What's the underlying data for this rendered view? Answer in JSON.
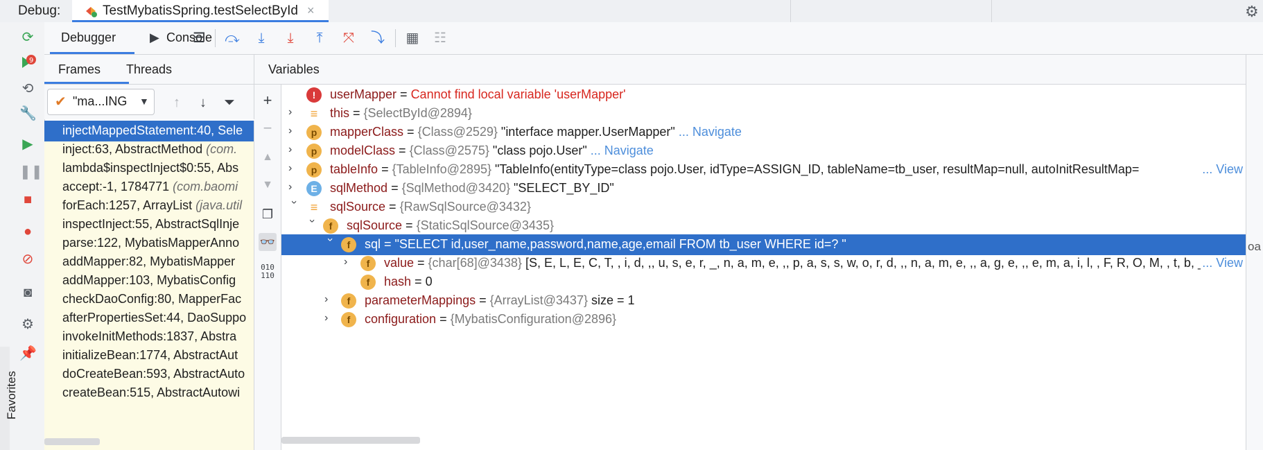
{
  "topbar": {
    "debug_label": "Debug:",
    "session_title": "TestMybatisSpring.testSelectById",
    "close_glyph": "×"
  },
  "toolbar": {
    "debugger_tab": "Debugger",
    "console_tab": "Console",
    "buttons": [
      "hamburger-menu-icon",
      "show-execution-point-icon",
      "step-over-icon",
      "step-into-icon",
      "force-step-into-icon",
      "step-out-icon",
      "drop-frame-icon",
      "run-to-cursor-icon",
      "evaluate-expression-icon",
      "trace-current-stream-icon"
    ]
  },
  "left_toolbar": {
    "favorites": "Favorites",
    "buttons": [
      "rerun-icon",
      "rerun-failed-icon",
      "restore-layout-icon",
      "settings-wrench-icon",
      "resume-icon",
      "pause-icon",
      "stop-icon",
      "view-breakpoints-icon",
      "mute-breakpoints-icon",
      "camera-icon",
      "gear-icon",
      "pin-icon"
    ]
  },
  "frames": {
    "tab_frames": "Frames",
    "tab_threads": "Threads",
    "thread_combo": "\"ma...ING",
    "items": [
      {
        "text": "injectMappedStatement:40, Sele",
        "italic": ""
      },
      {
        "text": "inject:63, AbstractMethod ",
        "italic": "(com."
      },
      {
        "text": "lambda$inspectInject$0:55, Abs",
        "italic": ""
      },
      {
        "text": "accept:-1, 1784771 ",
        "italic": "(com.baomi"
      },
      {
        "text": "forEach:1257, ArrayList ",
        "italic": "(java.util"
      },
      {
        "text": "inspectInject:55, AbstractSqlInje",
        "italic": ""
      },
      {
        "text": "parse:122, MybatisMapperAnno",
        "italic": ""
      },
      {
        "text": "addMapper:82, MybatisMapper",
        "italic": ""
      },
      {
        "text": "addMapper:103, MybatisConfig",
        "italic": ""
      },
      {
        "text": "checkDaoConfig:80, MapperFac",
        "italic": ""
      },
      {
        "text": "afterPropertiesSet:44, DaoSuppo",
        "italic": ""
      },
      {
        "text": "invokeInitMethods:1837, Abstra",
        "italic": ""
      },
      {
        "text": "initializeBean:1774, AbstractAut",
        "italic": ""
      },
      {
        "text": "doCreateBean:593, AbstractAuto",
        "italic": ""
      },
      {
        "text": "createBean:515, AbstractAutowi",
        "italic": ""
      }
    ]
  },
  "variables": {
    "title": "Variables",
    "overflow_fragment": "oa",
    "rows": [
      {
        "name": "userMapper",
        "eq": " = ",
        "type": "",
        "value": "Cannot find local variable 'userMapper'",
        "link": "",
        "view": ""
      },
      {
        "name": "this",
        "eq": " = ",
        "type": "{SelectById@2894}",
        "value": "",
        "link": "",
        "view": ""
      },
      {
        "name": "mapperClass",
        "eq": " = ",
        "type": "{Class@2529}",
        "value": " \"interface mapper.UserMapper\"",
        "link": " ... Navigate",
        "view": ""
      },
      {
        "name": "modelClass",
        "eq": " = ",
        "type": "{Class@2575}",
        "value": " \"class pojo.User\"",
        "link": " ... Navigate",
        "view": ""
      },
      {
        "name": "tableInfo",
        "eq": " = ",
        "type": "{TableInfo@2895}",
        "value": " \"TableInfo(entityType=class pojo.User, idType=ASSIGN_ID, tableName=tb_user, resultMap=null, autoInitResultMap=",
        "link": "",
        "view": "... View"
      },
      {
        "name": "sqlMethod",
        "eq": " = ",
        "type": "{SqlMethod@3420}",
        "value": " \"SELECT_BY_ID\"",
        "link": "",
        "view": ""
      },
      {
        "name": "sqlSource",
        "eq": " = ",
        "type": "{RawSqlSource@3432}",
        "value": "",
        "link": "",
        "view": ""
      },
      {
        "name": "sqlSource",
        "eq": " = ",
        "type": "{StaticSqlSource@3435}",
        "value": "",
        "link": "",
        "view": ""
      },
      {
        "name": "sql",
        "eq": " = ",
        "type": "",
        "value": "\"SELECT id,user_name,password,name,age,email FROM tb_user WHERE id=? \"",
        "link": "",
        "view": ""
      },
      {
        "name": "value",
        "eq": " = ",
        "type": "{char[68]@3438}",
        "value": " [S, E, L, E, C, T,  , i, d, ,, u, s, e, r, _, n, a, m, e, ,, p, a, s, s, w, o, r, d, ,, n, a, m, e, ,, a, g, e, ,, e, m, a, i, l,  , F, R, O, M,  , t, b, _",
        "link": "",
        "view": "... View"
      },
      {
        "name": "hash",
        "eq": " = ",
        "type": "",
        "value": "0",
        "link": "",
        "view": ""
      },
      {
        "name": "parameterMappings",
        "eq": " = ",
        "type": "{ArrayList@3437}",
        "value": "  size = 1",
        "link": "",
        "view": ""
      },
      {
        "name": "configuration",
        "eq": " = ",
        "type": "{MybatisConfiguration@2896}",
        "value": "",
        "link": "",
        "view": ""
      }
    ]
  },
  "colors": {
    "accent": "#3b7de0",
    "selection": "#2f6fc9",
    "frames_bg": "#fdfbe5",
    "var_name": "#8b1a1a",
    "error": "#d7261e",
    "link": "#4d8edb"
  }
}
